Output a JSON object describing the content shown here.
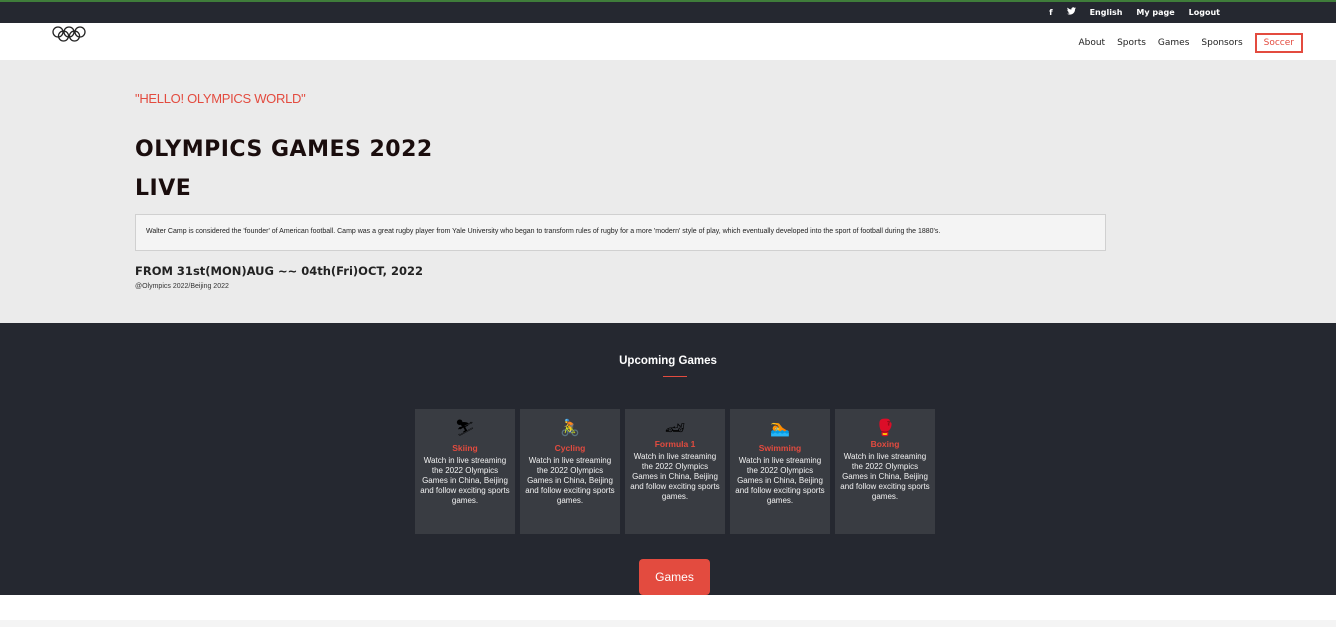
{
  "topbar": {
    "facebook_icon": "f",
    "twitter_icon": "🐦",
    "language": "English",
    "mypage": "My page",
    "logout": "Logout"
  },
  "nav": {
    "items": [
      "About",
      "Sports",
      "Games",
      "Sponsors",
      "Soccer"
    ]
  },
  "hero": {
    "hello": "\"HELLO! OLYMPICS WORLD\"",
    "title_line1": "OLYMPICS GAMES 2022",
    "title_line2": "LIVE",
    "description": "Walter Camp is considered the 'founder' of American football. Camp was a great rugby player from Yale University who began to transform rules of rugby for a more 'modern' style of play, which eventually developed into the sport of football during the 1880's.",
    "dates": "FROM 31st(MON)AUG ~~ 04th(Fri)OCT, 2022",
    "credit": "@Olympics 2022/Beijing 2022"
  },
  "upcoming": {
    "heading": "Upcoming Games",
    "cards": [
      {
        "icon": "⛷",
        "name": "Skiing",
        "text": "Watch in live streaming the 2022 Olympics Games in China, Beijing and follow exciting sports games."
      },
      {
        "icon": "🚴",
        "name": "Cycling",
        "text": "Watch in live streaming the 2022 Olympics Games in China, Beijing and follow exciting sports games."
      },
      {
        "icon": "🏎",
        "name": "Formula 1",
        "text": "Watch in live streaming the 2022 Olympics Games in China, Beijing and follow exciting sports games."
      },
      {
        "icon": "🏊",
        "name": "Swimming",
        "text": "Watch in live streaming the 2022 Olympics Games in China, Beijing and follow exciting sports games."
      },
      {
        "icon": "🥊",
        "name": "Boxing",
        "text": "Watch in live streaming the 2022 Olympics Games in China, Beijing and follow exciting sports games."
      }
    ],
    "button": "Games"
  },
  "colors": {
    "accent": "#e34b3f",
    "dark": "#252830",
    "card": "#393c42"
  }
}
